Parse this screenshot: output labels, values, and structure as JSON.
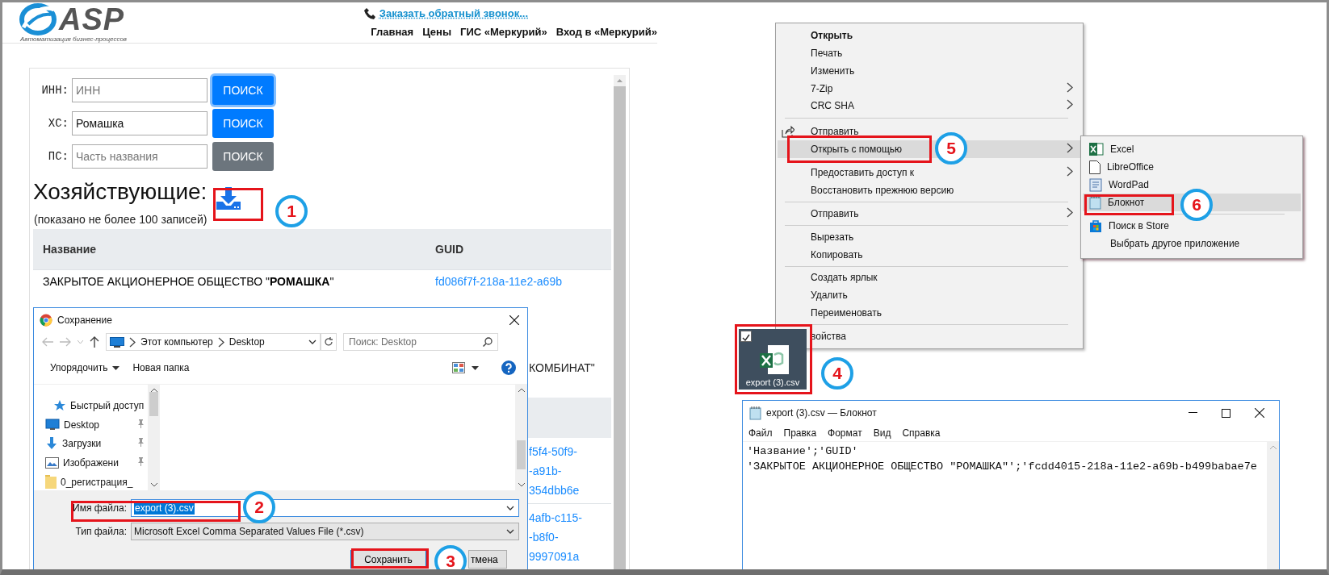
{
  "website": {
    "logo": {
      "name": "ASP",
      "tagline": "Автоматизация бизнес-процессов"
    },
    "callback_link": "Заказать обратный звонок...",
    "nav": [
      "Главная",
      "Цены",
      "ГИС «Меркурий»",
      "Вход в «Меркурий»"
    ],
    "search_rows": [
      {
        "label": "ИНН:",
        "placeholder": "ИНН",
        "button": "ПОИСК",
        "disabled": false,
        "focused": true
      },
      {
        "label": "ХС:",
        "value": "Ромашка",
        "button": "ПОИСК",
        "disabled": false,
        "focused": false
      },
      {
        "label": "ПС:",
        "placeholder": "Часть названия",
        "button": "ПОИСК",
        "disabled": true,
        "focused": false
      }
    ],
    "heading": "Хозяйствующие:",
    "note": "(показано не более 100 записей)",
    "table": {
      "columns": [
        "Название",
        "GUID"
      ],
      "rows": [
        {
          "kind": "row",
          "name": "ЗАКРЫТОЕ АКЦИОНЕРНОЕ ОБЩЕСТВО \"**РОМАШКА**\"",
          "guid": "fd086f7f-218a-11e2-a69b"
        },
        {
          "kind": "fragment",
          "text": "КОМБИНАТ\""
        },
        {
          "kind": "band"
        },
        {
          "kind": "link_fragment",
          "lines": [
            "f5f4-50f9-",
            "-a91b-",
            "354dbb6e"
          ]
        },
        {
          "kind": "link_fragment",
          "lines": [
            "4afb-c115-",
            "-b8f0-",
            "9997091a"
          ]
        }
      ]
    }
  },
  "save_dialog": {
    "title": "Сохранение",
    "path": [
      "Этот компьютер",
      "Desktop"
    ],
    "search_placeholder": "Поиск: Desktop",
    "toolbar": {
      "organize": "Упорядочить",
      "new_folder": "Новая папка"
    },
    "nav_items": [
      {
        "label": "Быстрый доступ",
        "pinned": false
      },
      {
        "label": "Desktop",
        "pinned": true
      },
      {
        "label": "Загрузки",
        "pinned": true
      },
      {
        "label": "Изображени",
        "pinned": true
      },
      {
        "label": "0_регистрация_",
        "pinned": false
      }
    ],
    "file_name_label": "Имя файла:",
    "file_name": "export (3).csv",
    "file_type_label": "Тип файла:",
    "file_type": "Microsoft Excel Comma Separated Values File (*.csv)",
    "buttons": [
      "Сохранить",
      "тмена"
    ]
  },
  "context_menu": {
    "items": [
      {
        "kind": "item",
        "label": "Открыть",
        "default": true,
        "submenu": false,
        "selected": false
      },
      {
        "kind": "item",
        "label": "Печать",
        "default": false,
        "submenu": false,
        "selected": false
      },
      {
        "kind": "item",
        "label": "Изменить",
        "default": false,
        "submenu": false,
        "selected": false
      },
      {
        "kind": "item",
        "label": "7-Zip",
        "default": false,
        "submenu": true,
        "selected": false
      },
      {
        "kind": "item",
        "label": "CRC SHA",
        "default": false,
        "submenu": true,
        "selected": false
      },
      {
        "kind": "separator"
      },
      {
        "kind": "share",
        "label": "Отправить",
        "default": false,
        "submenu": false,
        "selected": false
      },
      {
        "kind": "item",
        "label": "Открыть с помощью",
        "default": false,
        "submenu": true,
        "selected": true
      },
      {
        "kind": "item",
        "label": "Предоставить доступ к",
        "default": false,
        "submenu": true,
        "selected": false
      },
      {
        "kind": "item",
        "label": "Восстановить прежнюю версию",
        "default": false,
        "submenu": false,
        "selected": false
      },
      {
        "kind": "separator"
      },
      {
        "kind": "item",
        "label": "Отправить",
        "default": false,
        "submenu": true,
        "selected": false
      },
      {
        "kind": "separator"
      },
      {
        "kind": "item",
        "label": "Вырезать",
        "default": false,
        "submenu": false,
        "selected": false
      },
      {
        "kind": "item",
        "label": "Копировать",
        "default": false,
        "submenu": false,
        "selected": false
      },
      {
        "kind": "separator"
      },
      {
        "kind": "item",
        "label": "Создать ярлык",
        "default": false,
        "submenu": false,
        "selected": false
      },
      {
        "kind": "item",
        "label": "Удалить",
        "default": false,
        "submenu": false,
        "selected": false
      },
      {
        "kind": "item",
        "label": "Переименовать",
        "default": false,
        "submenu": false,
        "selected": false
      },
      {
        "kind": "separator"
      },
      {
        "kind": "item",
        "label": "войства",
        "default": false,
        "submenu": false,
        "selected": false
      }
    ]
  },
  "open_with_menu": {
    "items": [
      {
        "kind": "item",
        "label": "Excel",
        "selected": false
      },
      {
        "kind": "item",
        "label": "LibreOffice",
        "selected": false
      },
      {
        "kind": "item",
        "label": "WordPad",
        "selected": false
      },
      {
        "kind": "item",
        "label": "Блокнот",
        "selected": true
      },
      {
        "kind": "separator"
      },
      {
        "kind": "item",
        "label": "Поиск в Store",
        "selected": false
      },
      {
        "kind": "item",
        "label": "Выбрать другое приложение",
        "selected": false
      }
    ]
  },
  "desktop_file": {
    "label": "export (3).csv",
    "checked": true
  },
  "notepad": {
    "title": "export (3).csv — Блокнот",
    "menu": [
      "Файл",
      "Правка",
      "Формат",
      "Вид",
      "Справка"
    ],
    "lines": [
      "'Название';'GUID'",
      "'ЗАКРЫТОЕ АКЦИОНЕРНОЕ ОБЩЕСТВО \"РОМАШКА\"';'fcdd4015-218a-11e2-a69b-b499babae7e"
    ]
  },
  "steps": [
    {
      "number": "1"
    },
    {
      "number": "2"
    },
    {
      "number": "3"
    },
    {
      "number": "4"
    },
    {
      "number": "5"
    },
    {
      "number": "6"
    }
  ]
}
